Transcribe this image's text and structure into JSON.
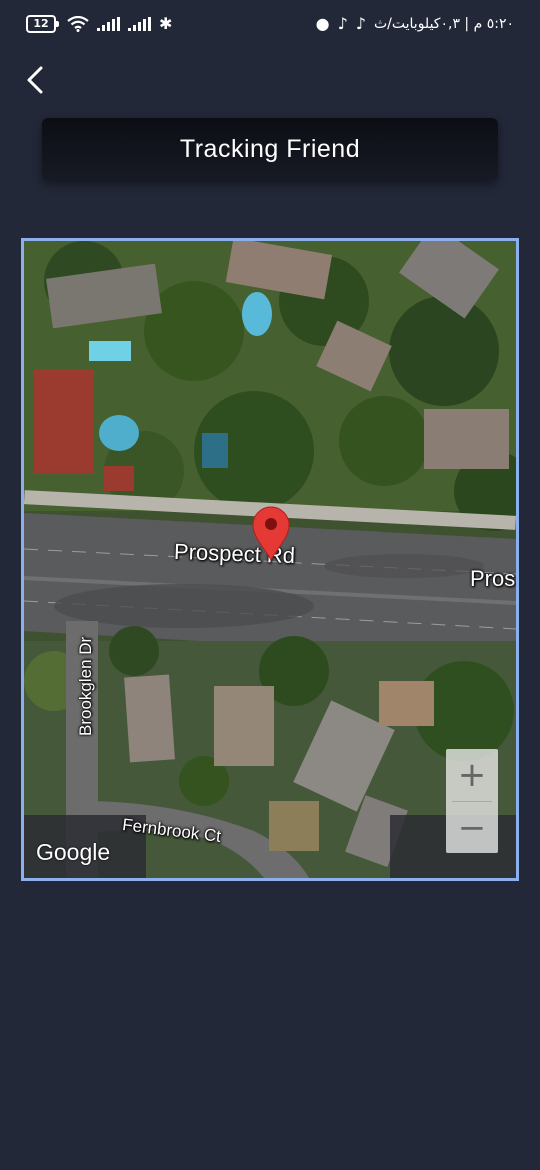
{
  "status_bar": {
    "battery_level": "12",
    "time": "٥:٢٠ م | ٠,٣كيلوبايت/ث"
  },
  "header": {
    "back_icon": "chevron-left-icon",
    "title": "Tracking Friend"
  },
  "map": {
    "labels": {
      "prospect_rd": "Prospect Rd",
      "prospect_rd_partial": "Pros",
      "brookglen_dr": "Brookglen Dr",
      "fernbrook_ct": "Fernbrook Ct"
    },
    "attribution": "Google",
    "zoom_in_label": "+",
    "zoom_out_label": "−",
    "marker_icon": "map-pin-icon",
    "marker_color": "#e53935"
  },
  "colors": {
    "background": "#232839",
    "map_border": "#8cb0ee"
  }
}
